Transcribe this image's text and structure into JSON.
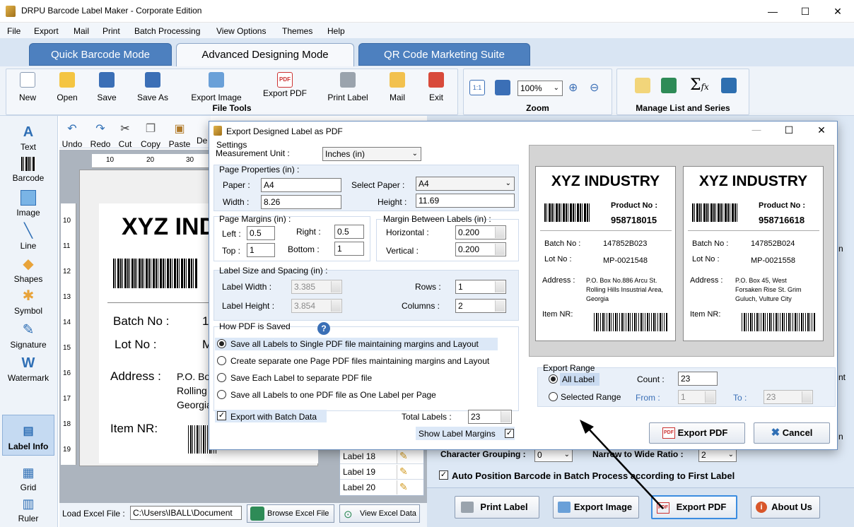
{
  "window": {
    "title": "DRPU Barcode Label Maker - Corporate Edition",
    "minimize": "—",
    "maximize": "☐",
    "close": "✕"
  },
  "menu": [
    "File",
    "Export",
    "Mail",
    "Print",
    "Batch Processing",
    "View Options",
    "Themes",
    "Help"
  ],
  "mode_tabs": [
    "Quick Barcode Mode",
    "Advanced Designing Mode",
    "QR Code Marketing Suite"
  ],
  "file_tools": {
    "group": "File Tools",
    "buttons": [
      "New",
      "Open",
      "Save",
      "Save As",
      "Export Image",
      "Export PDF",
      "Print Label",
      "Mail",
      "Exit"
    ]
  },
  "zoom": {
    "group": "Zoom",
    "value": "100%"
  },
  "manage": {
    "group": "Manage List and Series"
  },
  "tools": [
    "Text",
    "Barcode",
    "Image",
    "Line",
    "Shapes",
    "Symbol",
    "Signature",
    "Watermark",
    "Label Info",
    "Grid",
    "Ruler"
  ],
  "edit_tools": [
    "Undo",
    "Redo",
    "Cut",
    "Copy",
    "Paste",
    "De"
  ],
  "ruler_top": [
    "10",
    "20",
    "30"
  ],
  "ruler_left": [
    "10",
    "11",
    "12",
    "13",
    "14",
    "15",
    "16",
    "17",
    "18",
    "19",
    "20"
  ],
  "design_label": {
    "company": "XYZ IND",
    "batch_label": "Batch No :",
    "batch_val": "1",
    "lot_label": "Lot No :",
    "lot_val": "M",
    "address_label": "Address :",
    "address_lines": [
      "P.O. Bo",
      "Rolling",
      "Georgia"
    ],
    "item_label": "Item NR:"
  },
  "label_list": [
    {
      "name": "Label 18"
    },
    {
      "name": "Label 19"
    },
    {
      "name": "Label 20"
    }
  ],
  "excel": {
    "label": "Load Excel File :",
    "path": "C:\\Users\\IBALL\\Document",
    "browse": "Browse Excel File",
    "view": "View Excel Data"
  },
  "right_panel": {
    "character_grouping_label": "Character Grouping :",
    "character_grouping_val": "0",
    "ratio_label": "Narrow to Wide Ratio :",
    "ratio_val": "2",
    "auto_position": "Auto Position Barcode in Batch Process according to First Label",
    "btn_print": "Print Label",
    "btn_export_image": "Export Image",
    "btn_export_pdf": "Export PDF",
    "btn_about": "About Us",
    "edge_text_1": "n",
    "edge_text_2": "nt",
    "edge_text_3": "n"
  },
  "dialog": {
    "title": "Export Designed Label as PDF",
    "settings": "Settings",
    "measurement_label": "Measurement Unit :",
    "measurement_val": "Inches (in)",
    "page_props": "Page Properties (in) :",
    "paper_label": "Paper :",
    "paper_val": "A4",
    "select_paper_label": "Select Paper :",
    "select_paper_val": "A4",
    "width_label": "Width :",
    "width_val": "8.26",
    "height_label": "Height :",
    "height_val": "11.69",
    "margins": "Page Margins (in) :",
    "left_label": "Left :",
    "left_val": "0.5",
    "right_label": "Right :",
    "right_val": "0.5",
    "top_label": "Top :",
    "top_val": "1",
    "bottom_label": "Bottom :",
    "bottom_val": "1",
    "mbl": "Margin Between Labels (in) :",
    "horizontal_label": "Horizontal :",
    "horizontal_val": "0.200",
    "vertical_label": "Vertical :",
    "vertical_val": "0.200",
    "size": "Label Size and Spacing (in) :",
    "lw_label": "Label Width :",
    "lw_val": "3.385",
    "lh_label": "Label Height :",
    "lh_val": "3.854",
    "rows_label": "Rows :",
    "rows_val": "1",
    "cols_label": "Columns :",
    "cols_val": "2",
    "how": "How PDF is Saved",
    "help": "?",
    "options": [
      "Save all Labels to Single PDF file maintaining margins and Layout",
      "Create separate one Page PDF files maintaining margins and Layout",
      "Save Each Label to separate PDF file",
      "Save all Labels to one PDF file as One Label per Page"
    ],
    "batch": "Export with Batch Data",
    "total_label": "Total Labels :",
    "total_val": "23",
    "show_margins": "Show Label Margins",
    "range": "Export Range",
    "all_label": "All Label",
    "count_label": "Count :",
    "count_val": "23",
    "selected_label": "Selected Range",
    "from_label": "From :",
    "from_val": "1",
    "to_label": "To :",
    "to_val": "23",
    "export_btn": "Export PDF",
    "cancel_btn": "Cancel"
  },
  "preview": [
    {
      "company": "XYZ INDUSTRY",
      "product_label": "Product No :",
      "product": "958718015",
      "batch_label": "Batch No :",
      "batch": "147852B023",
      "lot_label": "Lot No :",
      "lot": "MP-0021548",
      "address_label": "Address :",
      "address": [
        "P.O. Box No.886 Arcu St.",
        "Rolling Hills Insustrial Area,",
        "Georgia"
      ],
      "item_label": "Item NR:"
    },
    {
      "company": "XYZ INDUSTRY",
      "product_label": "Product No :",
      "product": "958716618",
      "batch_label": "Batch No :",
      "batch": "147852B024",
      "lot_label": "Lot No :",
      "lot": "MP-0021558",
      "address_label": "Address :",
      "address": [
        "P.O. Box 45, West",
        "Forsaken Rise St. Grim",
        "Guluch, Vulture City"
      ],
      "item_label": "Item NR:"
    }
  ]
}
